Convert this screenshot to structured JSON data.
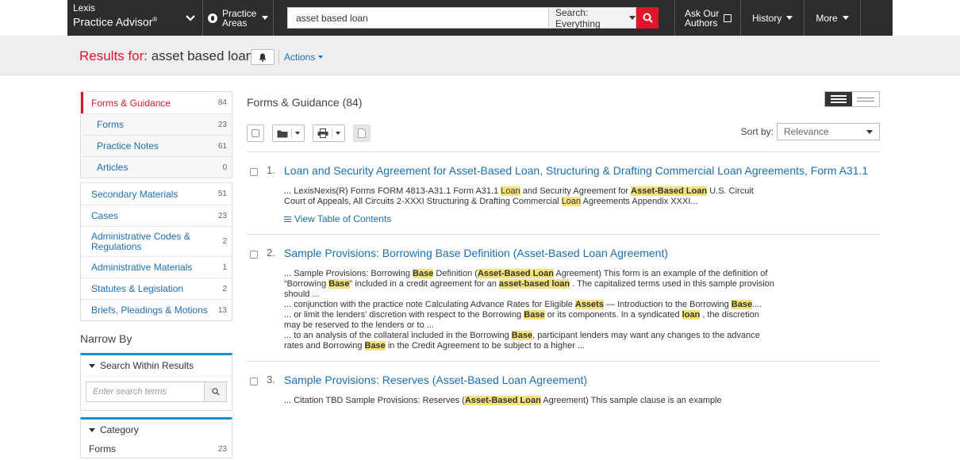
{
  "header": {
    "brand_line1": "Lexis",
    "brand_line2": "Practice Advisor",
    "brand_mark": "®",
    "practice_areas_line1": "Practice",
    "practice_areas_line2": "Areas",
    "search_value": "asset based loan",
    "search_scope": "Search: Everything",
    "ask_line1": "Ask Our",
    "ask_line2": "Authors",
    "history": "History",
    "more": "More"
  },
  "results_bar": {
    "label": "Results for:",
    "query": "asset based loan",
    "actions": "Actions"
  },
  "facets": {
    "primary": [
      {
        "label": "Forms & Guidance",
        "count": "84"
      }
    ],
    "sub": [
      {
        "label": "Forms",
        "count": "23"
      },
      {
        "label": "Practice Notes",
        "count": "61"
      },
      {
        "label": "Articles",
        "count": "0"
      }
    ],
    "others": [
      {
        "label": "Secondary Materials",
        "count": "51"
      },
      {
        "label": "Cases",
        "count": "23"
      },
      {
        "label": "Administrative Codes & Regulations",
        "count": "2"
      },
      {
        "label": "Administrative Materials",
        "count": "1"
      },
      {
        "label": "Statutes & Legislation",
        "count": "2"
      },
      {
        "label": "Briefs, Pleadings & Motions",
        "count": "13"
      }
    ],
    "narrow_by": "Narrow By",
    "search_within": "Search Within Results",
    "search_placeholder": "Enter search terms",
    "category": "Category",
    "category_items": [
      {
        "label": "Forms",
        "count": "23"
      }
    ]
  },
  "main": {
    "heading": "Forms & Guidance (84)",
    "sort_label": "Sort by:",
    "sort_value": "Relevance",
    "view_toc": "View Table of Contents",
    "results": [
      {
        "num": "1.",
        "title": "Loan and Security Agreement for Asset-Based Loan, Structuring & Drafting Commercial Loan Agreements, Form A31.1"
      },
      {
        "num": "2.",
        "title": "Sample Provisions: Borrowing Base Definition (Asset-Based Loan Agreement)"
      },
      {
        "num": "3.",
        "title": "Sample Provisions: Reserves (Asset-Based Loan Agreement)"
      }
    ],
    "snippets": {
      "r1": [
        "... LexisNexis(R) Forms FORM 4813-A31.1 Form A31.1 ",
        "Loan",
        " and Security Agreement for ",
        "Asset-Based Loan",
        " U.S. Circuit Court of Appeals, All Circuits 2-XXXI Structuring & Drafting Commercial ",
        "Loan",
        " Agreements Appendix XXXI..."
      ],
      "r2a": [
        "... Sample Provisions: Borrowing ",
        "Base",
        " Definition (",
        "Asset-Based Loan",
        " Agreement) This form is an example of the definition of “Borrowing ",
        "Base",
        "” included in a credit agreement for an ",
        "asset-based loan",
        " . The capitalized terms used in this sample provision should ..."
      ],
      "r2b": [
        "... conjunction with the practice note Calculating Advance Rates for Eligible ",
        "Assets",
        " — Introduction to the Borrowing ",
        "Base",
        "...."
      ],
      "r2c": [
        "... or limit the lenders' discretion with respect to the Borrowing ",
        "Base",
        " or its components. In a syndicated ",
        "loan",
        " , the discretion may be reserved to the lenders or to ..."
      ],
      "r2d": [
        "... to an analysis of the collateral included in the Borrowing ",
        "Base",
        ", participant lenders may want any changes to the advance rates and Borrowing ",
        "Base",
        " in the Credit Agreement to be subject to a higher ..."
      ],
      "r3": [
        "... Citation TBD Sample Provisions: Reserves (",
        "Asset-Based Loan",
        " Agreement) This sample clause is an example"
      ]
    }
  },
  "colors": {
    "accent_red": "#e3142c",
    "link_blue": "#1a6fb5",
    "highlight": "#f6e27a",
    "topbar": "#2d2d2d"
  }
}
